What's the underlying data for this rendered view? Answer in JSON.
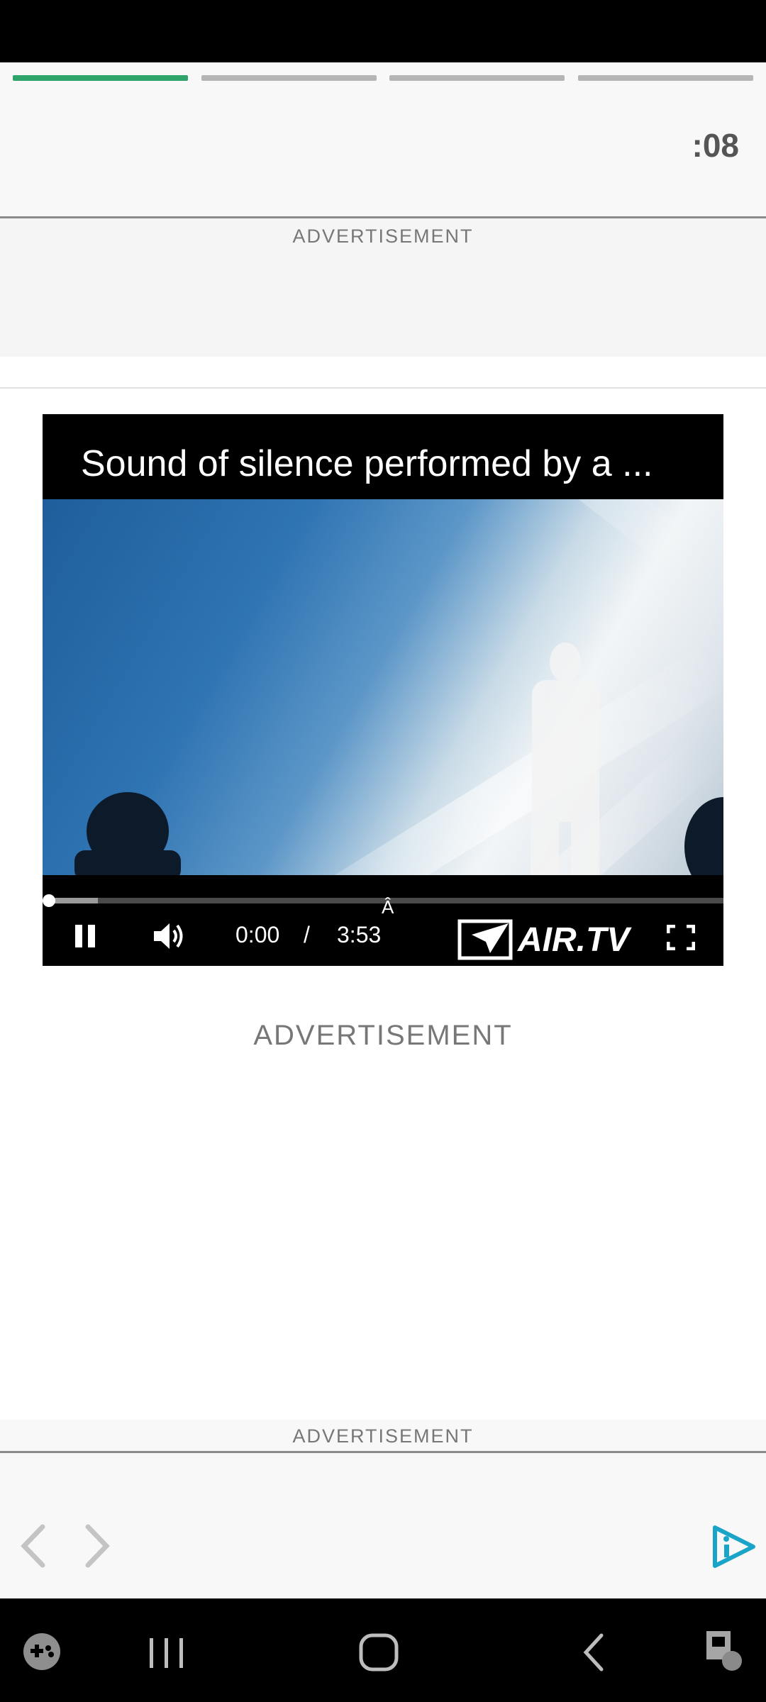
{
  "header": {
    "timer": ":08",
    "progress_segments": [
      {
        "state": "active"
      },
      {
        "state": "inactive"
      },
      {
        "state": "inactive"
      },
      {
        "state": "inactive"
      }
    ],
    "accent_color": "#2ea36a"
  },
  "ads": {
    "top_label": "ADVERTISEMENT",
    "middle_label": "ADVERTISEMENT",
    "bottom_label": "ADVERTISEMENT"
  },
  "video": {
    "title": "Sound of silence performed by a ...",
    "current_time": "0:00",
    "separator": "/",
    "duration": "3:53",
    "stray_char": "Â",
    "brand": "AIR.TV",
    "progress_fraction": 0,
    "buffered_fraction": 0.08,
    "icons": [
      "pause-icon",
      "volume-icon",
      "airtv-logo",
      "fullscreen-icon"
    ]
  },
  "pager": {
    "icons": [
      "chevron-left-icon",
      "chevron-right-icon",
      "info-play-icon"
    ],
    "brand_color": "#1aa5c8"
  },
  "system_nav": {
    "icons": [
      "game-launcher-icon",
      "recent-apps-icon",
      "home-icon",
      "back-icon",
      "accessibility-icon"
    ]
  }
}
